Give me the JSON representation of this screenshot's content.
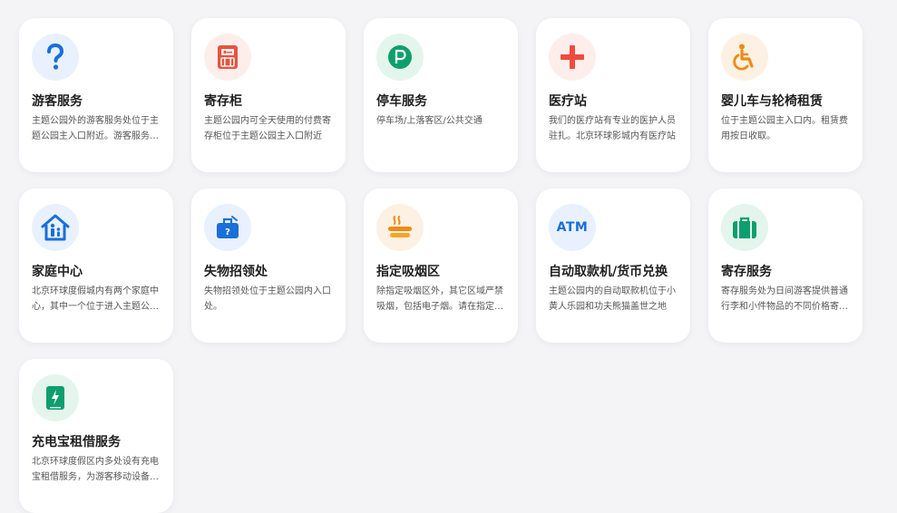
{
  "cards": [
    {
      "title": "游客服务",
      "desc": "主题公园外的游客服务处位于主题公园主入口附近。游客服务处提供咨询服务",
      "icon": "question-icon",
      "color": "#1a6fd8"
    },
    {
      "title": "寄存柜",
      "desc": "主题公园内可全天使用的付费寄存柜位于主题公园主入口附近",
      "icon": "locker-icon",
      "color": "#e8533f"
    },
    {
      "title": "停车服务",
      "desc": "停车场/上落客区/公共交通",
      "icon": "parking-icon",
      "color": "#0e9f6e"
    },
    {
      "title": "医疗站",
      "desc": "我们的医疗站有专业的医护人员驻扎。北京环球影城内有医疗站",
      "icon": "medical-cross-icon",
      "color": "#ef4b3c"
    },
    {
      "title": "婴儿车与轮椅租赁",
      "desc": "位于主题公园主入口内。租赁费用按日收取。",
      "icon": "wheelchair-icon",
      "color": "#f08a12"
    },
    {
      "title": "家庭中心",
      "desc": "北京环球度假城内有两个家庭中心，其中一个位于进入主题公园后",
      "icon": "family-house-icon",
      "color": "#1a6fd8"
    },
    {
      "title": "失物招领处",
      "desc": "失物招领处位于主题公园内入口处。",
      "icon": "lost-found-icon",
      "color": "#1a6fd8"
    },
    {
      "title": "指定吸烟区",
      "desc": "除指定吸烟区外，其它区域严禁吸烟，包括电子烟。请在指定区域吸烟",
      "icon": "smoking-icon",
      "color": "#f08a12"
    },
    {
      "title": "自动取款机/货币兑换",
      "desc": "主题公园内的自动取款机位于小黄人乐园和功夫熊猫盖世之地",
      "icon": "atm-icon",
      "color": "#1a6fd8"
    },
    {
      "title": "寄存服务",
      "desc": "寄存服务处为日间游客提供普通行李和小件物品的不同价格寄存服务",
      "icon": "luggage-icon",
      "color": "#0e9f6e"
    },
    {
      "title": "充电宝租借服务",
      "desc": "北京环球度假区内多处设有充电宝租借服务，为游客移动设备提供电力",
      "icon": "power-bank-icon",
      "color": "#0e9f6e"
    }
  ],
  "atm_label": "ATM"
}
